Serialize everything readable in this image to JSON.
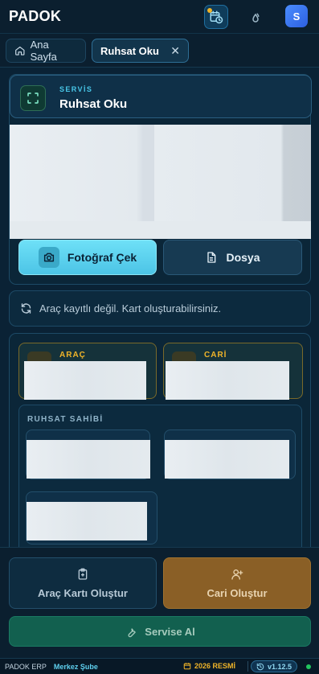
{
  "app": {
    "brand": "PADOK"
  },
  "tabs": [
    {
      "label": "Ana Sayfa",
      "icon": "home-icon"
    },
    {
      "label": "Ruhsat Oku",
      "icon": "close-icon"
    }
  ],
  "service": {
    "kicker": "SERVİS",
    "title": "Ruhsat Oku"
  },
  "upload": {
    "photo_label": "Fotoğraf Çek",
    "file_label": "Dosya"
  },
  "status": {
    "message": "Araç kayıtlı değil. Kart oluşturabilirsiniz."
  },
  "vehicle_card": {
    "header": "ARAÇ"
  },
  "customer_card": {
    "header": "CARİ"
  },
  "owner": {
    "title": "RUHSAT SAHİBİ"
  },
  "actions": {
    "create_vehicle": "Araç Kartı Oluştur",
    "create_customer": "Cari Oluştur",
    "take_service": "Servise Al"
  },
  "statusbar": {
    "app_name": "PADOK ERP",
    "branch": "Merkez Şube",
    "fiscal": "2026 RESMİ",
    "version": "v1.12.5"
  },
  "colors": {
    "accent_cyan": "#4cc4e6",
    "accent_gold": "#f0b429",
    "cari_button": "#8a5f26",
    "service_button": "#12604f",
    "online_dot": "#22c55e"
  }
}
